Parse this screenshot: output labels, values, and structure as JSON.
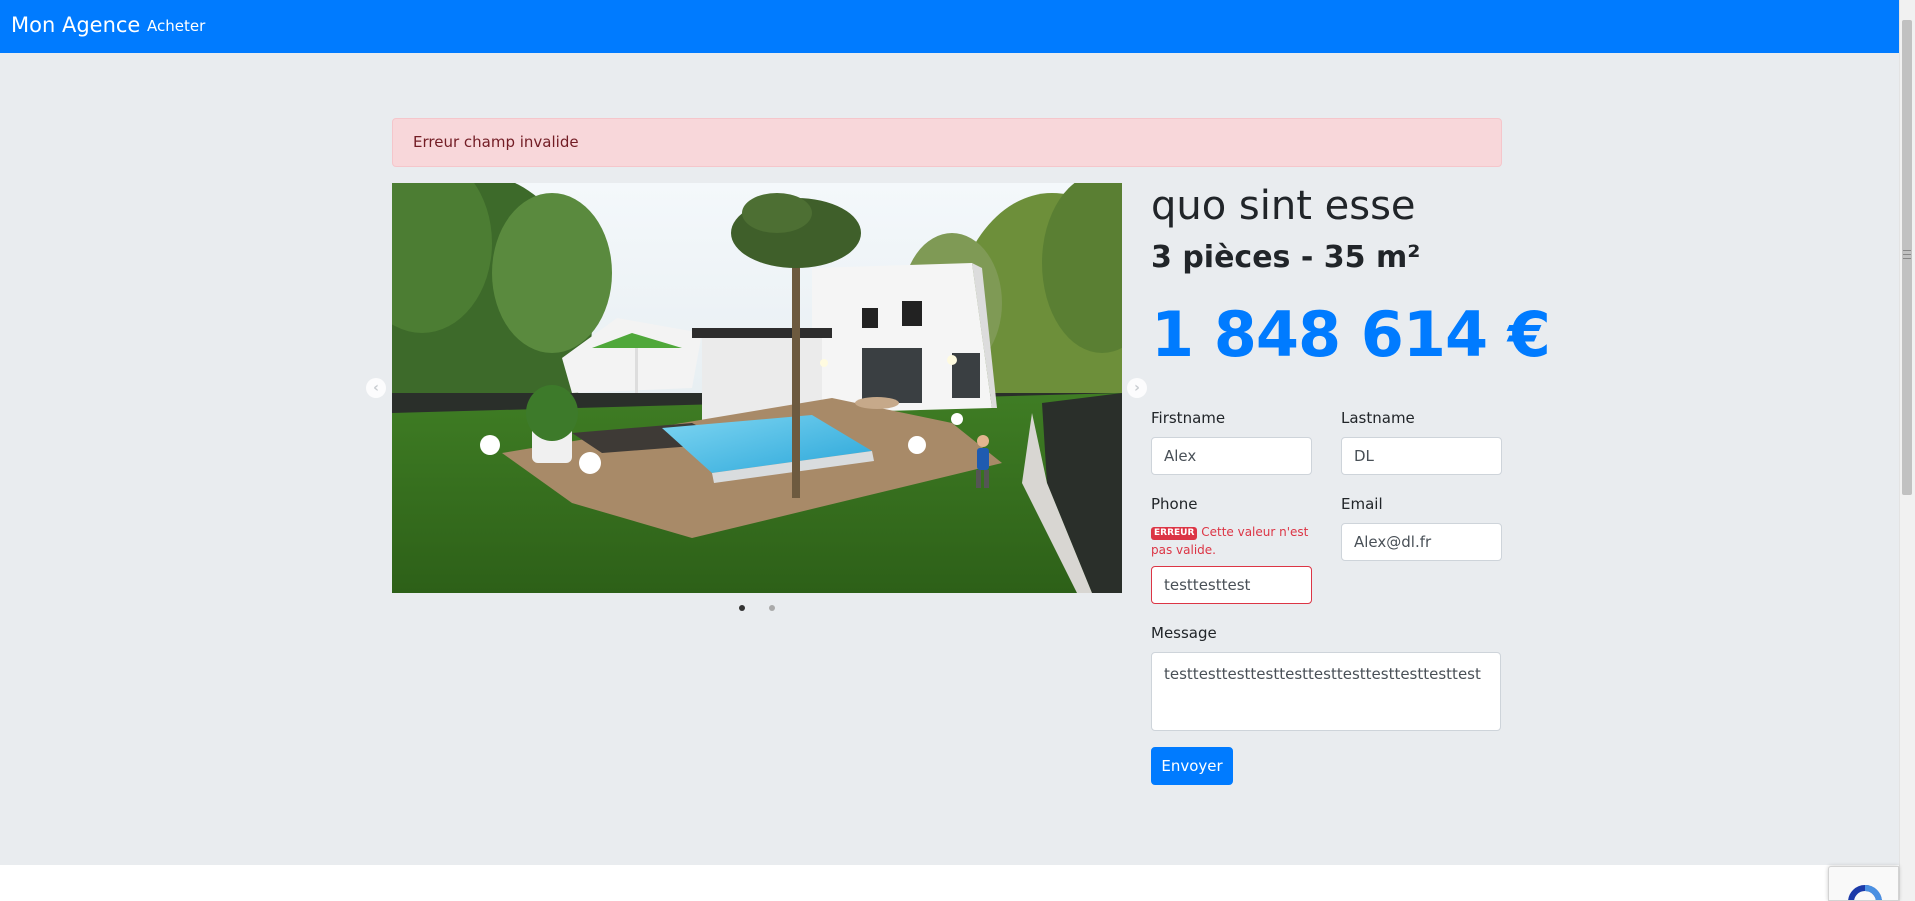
{
  "navbar": {
    "brand": "Mon Agence",
    "link": "Acheter"
  },
  "alert": {
    "text": "Erreur champ invalide"
  },
  "carousel": {
    "prev_icon": "chevron-left-icon",
    "next_icon": "chevron-right-icon",
    "prev_glyph": "‹",
    "next_glyph": "›",
    "slide_count": 2,
    "active_index": 1
  },
  "property": {
    "title": "quo sint esse",
    "details": "3 pièces - 35 m²",
    "price": "1 848 614 €"
  },
  "form": {
    "firstname": {
      "label": "Firstname",
      "value": "Alex"
    },
    "lastname": {
      "label": "Lastname",
      "value": "DL"
    },
    "phone": {
      "label": "Phone",
      "value": "testtesttest",
      "error_badge": "ERREUR",
      "error_text": "Cette valeur n'est pas valide."
    },
    "email": {
      "label": "Email",
      "value": "Alex@dl.fr"
    },
    "message": {
      "label": "Message",
      "value": "testtesttesttesttesttesttesttesttesttesttest"
    },
    "submit": "Envoyer"
  },
  "colors": {
    "primary": "#007bff",
    "danger": "#dc3545",
    "alert_bg": "#f8d7da",
    "page_bg": "#e9ecef"
  }
}
